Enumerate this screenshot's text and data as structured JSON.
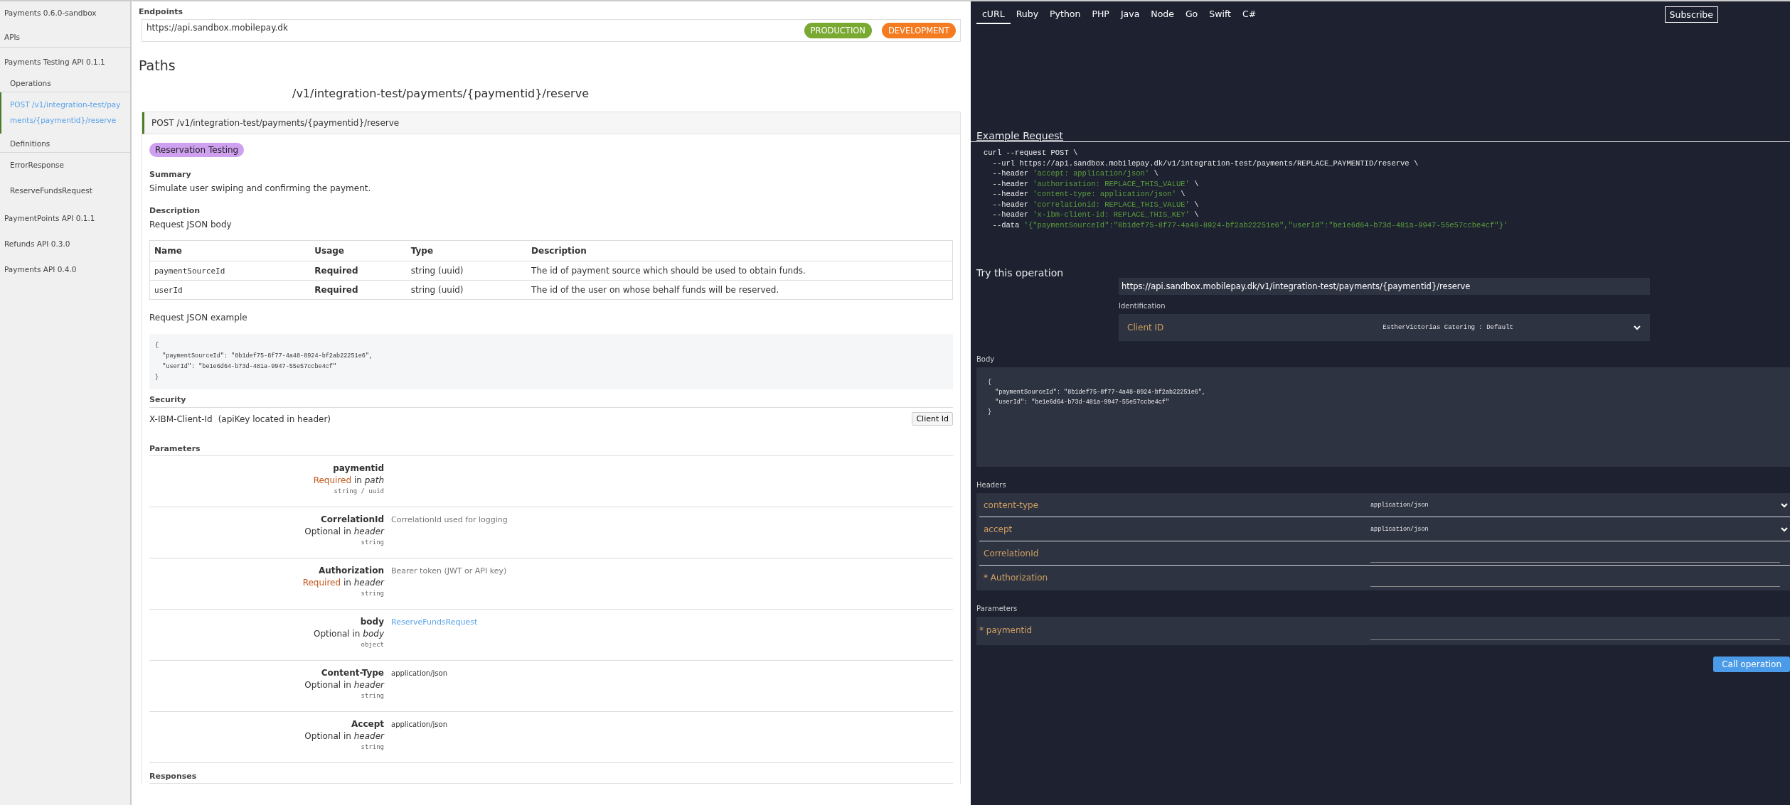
{
  "sidebar": {
    "title": "Payments 0.6.0-sandbox",
    "section": "APIs",
    "apis": [
      {
        "name": "Payments Testing API 0.1.1",
        "groups": [
          {
            "label": "Operations",
            "items": [
              {
                "label": "POST /v1/integration-test/payments/{paymentid}/reserve",
                "selected": true
              }
            ]
          },
          {
            "label": "Definitions",
            "items": [
              {
                "label": "ErrorResponse",
                "selected": false
              },
              {
                "label": "ReserveFundsRequest",
                "selected": false
              }
            ]
          }
        ]
      },
      {
        "name": "PaymentPoints API 0.1.1"
      },
      {
        "name": "Refunds API 0.3.0"
      },
      {
        "name": "Payments API 0.4.0"
      }
    ]
  },
  "main": {
    "endpoints": {
      "label": "Endpoints",
      "url": "https://api.sandbox.mobilepay.dk",
      "environments": [
        {
          "label": "PRODUCTION",
          "color": "#7aa932"
        },
        {
          "label": "DEVELOPMENT",
          "color": "#f47b20"
        }
      ]
    },
    "paths_heading": "Paths",
    "path_title": "/v1/integration-test/payments/{paymentid}/reserve",
    "operation": {
      "header": "POST /v1/integration-test/payments/{paymentid}/reserve",
      "tag": "Reservation Testing",
      "summary_label": "Summary",
      "summary": "Simulate user swiping and confirming the payment.",
      "description_label": "Description",
      "description": "Request JSON body",
      "table": {
        "columns": [
          "Name",
          "Usage",
          "Type",
          "Description"
        ],
        "rows": [
          [
            "paymentSourceId",
            "Required",
            "string (uuid)",
            "The id of payment source which should be used to obtain funds."
          ],
          [
            "userId",
            "Required",
            "string (uuid)",
            "The id of the user on whose behalf funds will be reserved."
          ]
        ]
      },
      "example_label": "Request JSON example",
      "example_code": "{\n  \"paymentSourceId\": \"8b1def75-8f77-4a48-8924-bf2ab22251e6\",\n  \"userId\": \"be1e6d64-b73d-481a-9947-55e57ccbe4cf\"\n}",
      "security_label": "Security",
      "security": {
        "name": "X-IBM-Client-Id",
        "note": "(apiKey located in header)",
        "button": "Client Id"
      },
      "parameters_label": "Parameters",
      "parameters": [
        {
          "name": "paymentid",
          "usage": "Required",
          "required": true,
          "in": "in",
          "location": "path",
          "type": "string / uuid"
        },
        {
          "name": "CorrelationId",
          "usage": "Optional",
          "required": false,
          "in": "in",
          "location": "header",
          "type": "string",
          "description": "CorrelationId used for logging",
          "kind": "text"
        },
        {
          "name": "Authorization",
          "usage": "Required",
          "required": true,
          "in": "in",
          "location": "header",
          "type": "string",
          "description": "Bearer token (JWT or API key)",
          "kind": "text"
        },
        {
          "name": "body",
          "usage": "Optional",
          "required": false,
          "in": "in",
          "location": "body",
          "type": "object",
          "description": "ReserveFundsRequest",
          "kind": "link"
        },
        {
          "name": "Content-Type",
          "usage": "Optional",
          "required": false,
          "in": "in",
          "location": "header",
          "type": "string",
          "description": "application/json",
          "kind": "value"
        },
        {
          "name": "Accept",
          "usage": "Optional",
          "required": false,
          "in": "in",
          "location": "header",
          "type": "string",
          "description": "application/json",
          "kind": "value"
        }
      ],
      "responses_label": "Responses"
    }
  },
  "panel": {
    "tabs": [
      {
        "label": "cURL",
        "selected": true
      },
      {
        "label": "Ruby",
        "selected": false
      },
      {
        "label": "Python",
        "selected": false
      },
      {
        "label": "PHP",
        "selected": false
      },
      {
        "label": "Java",
        "selected": false
      },
      {
        "label": "Node",
        "selected": false
      },
      {
        "label": "Go",
        "selected": false
      },
      {
        "label": "Swift",
        "selected": false
      },
      {
        "label": "C#",
        "selected": false
      }
    ],
    "subscribe": "Subscribe",
    "example_title": "Example Request",
    "example_lines": [
      [
        {
          "text": "curl --request POST \\",
          "kind": "plain"
        }
      ],
      [
        {
          "text": "  --url https://api.sandbox.mobilepay.dk/v1/integration-test/payments/REPLACE_PAYMENTID/reserve \\",
          "kind": "plain"
        }
      ],
      [
        {
          "text": "  --header ",
          "kind": "plain"
        },
        {
          "text": "'accept: application/json'",
          "kind": "string"
        },
        {
          "text": " \\",
          "kind": "plain"
        }
      ],
      [
        {
          "text": "  --header ",
          "kind": "plain"
        },
        {
          "text": "'authorisation: REPLACE_THIS_VALUE'",
          "kind": "string"
        },
        {
          "text": " \\",
          "kind": "plain"
        }
      ],
      [
        {
          "text": "  --header ",
          "kind": "plain"
        },
        {
          "text": "'content-type: application/json'",
          "kind": "string"
        },
        {
          "text": " \\",
          "kind": "plain"
        }
      ],
      [
        {
          "text": "  --header ",
          "kind": "plain"
        },
        {
          "text": "'correlationid: REPLACE_THIS_VALUE'",
          "kind": "string"
        },
        {
          "text": " \\",
          "kind": "plain"
        }
      ],
      [
        {
          "text": "  --header ",
          "kind": "plain"
        },
        {
          "text": "'x-ibm-client-id: REPLACE_THIS_KEY'",
          "kind": "string"
        },
        {
          "text": " \\",
          "kind": "plain"
        }
      ],
      [
        {
          "text": "  --data ",
          "kind": "plain"
        },
        {
          "text": "'{\"paymentSourceId\":\"8b1def75-8f77-4a48-8924-bf2ab22251e6\",\"userId\":\"be1e6d64-b73d-481a-9947-55e57ccbe4cf\"}'",
          "kind": "string"
        }
      ]
    ],
    "try_title": "Try this operation",
    "try_url": "https://api.sandbox.mobilepay.dk/v1/integration-test/payments/{paymentid}/reserve",
    "identification_label": "Identification",
    "client": {
      "label": "Client ID",
      "value": "EstherVictorias Catering : Default"
    },
    "body_label": "Body",
    "body_code": "{\n  \"paymentSourceId\": \"8b1def75-8f77-4a48-8924-bf2ab22251e6\",\n  \"userId\": \"be1e6d64-b73d-481a-9947-55e57ccbe4cf\"\n}",
    "headers_label": "Headers",
    "headers": [
      {
        "label": "content-type",
        "kind": "select",
        "value": "application/json"
      },
      {
        "label": "accept",
        "kind": "select",
        "value": "application/json"
      },
      {
        "label": "CorrelationId",
        "kind": "input"
      },
      {
        "label": "* Authorization",
        "kind": "input"
      }
    ],
    "parameters_label": "Parameters",
    "parameters": [
      {
        "label": "* paymentid",
        "kind": "input"
      }
    ],
    "call_button": "Call operation"
  }
}
